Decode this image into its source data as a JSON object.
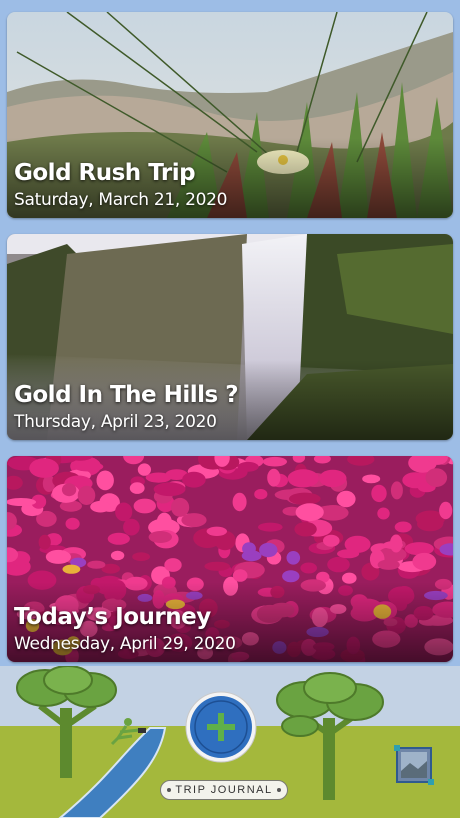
{
  "trips": [
    {
      "title": "Gold Rush Trip",
      "date": "Saturday, March 21, 2020"
    },
    {
      "title": "Gold In The Hills ?",
      "date": "Thursday, April 23, 2020"
    },
    {
      "title": "Today’s Journey",
      "date": "Wednesday, April 29, 2020"
    }
  ],
  "footer": {
    "journal_label": "TRIP JOURNAL",
    "add_icon": "plus-icon",
    "photo_icon": "photo-icon"
  },
  "colors": {
    "background": "#9dbde6",
    "grass": "#a4b83c",
    "add_button": "#2f6fbf",
    "add_plus": "#5fb04a"
  }
}
